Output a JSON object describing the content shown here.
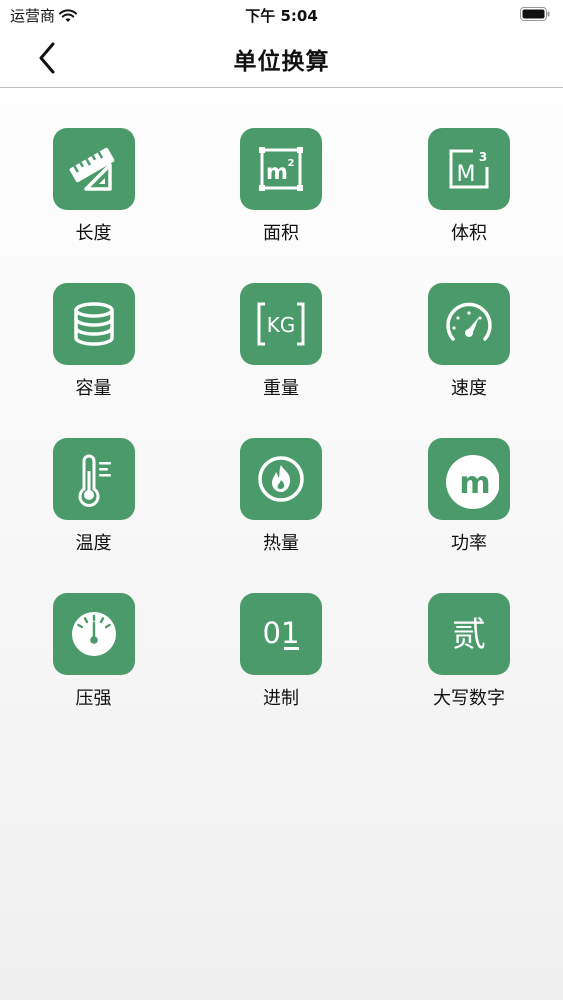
{
  "status_bar": {
    "carrier": "运营商",
    "time": "下午 5:04"
  },
  "nav": {
    "title": "单位换算"
  },
  "theme": {
    "tile_color": "#4a9a6a"
  },
  "items": [
    {
      "label": "长度",
      "icon": "ruler-triangle-icon"
    },
    {
      "label": "面积",
      "icon": "square-meter-icon"
    },
    {
      "label": "体积",
      "icon": "cubic-meter-icon"
    },
    {
      "label": "容量",
      "icon": "database-stack-icon"
    },
    {
      "label": "重量",
      "icon": "kilogram-icon"
    },
    {
      "label": "速度",
      "icon": "speedometer-icon"
    },
    {
      "label": "温度",
      "icon": "thermometer-icon"
    },
    {
      "label": "热量",
      "icon": "flame-icon"
    },
    {
      "label": "功率",
      "icon": "power-m-icon"
    },
    {
      "label": "压强",
      "icon": "pressure-gauge-icon"
    },
    {
      "label": "进制",
      "icon": "binary-icon"
    },
    {
      "label": "大写数字",
      "icon": "chinese-numeral-icon"
    }
  ],
  "icon_text": {
    "square_meter": "m",
    "square_sup": "2",
    "cubic_meter": "M",
    "cubic_sup": "3",
    "kilogram": "KG",
    "power": "m",
    "binary": "01",
    "numeral": "贰"
  }
}
